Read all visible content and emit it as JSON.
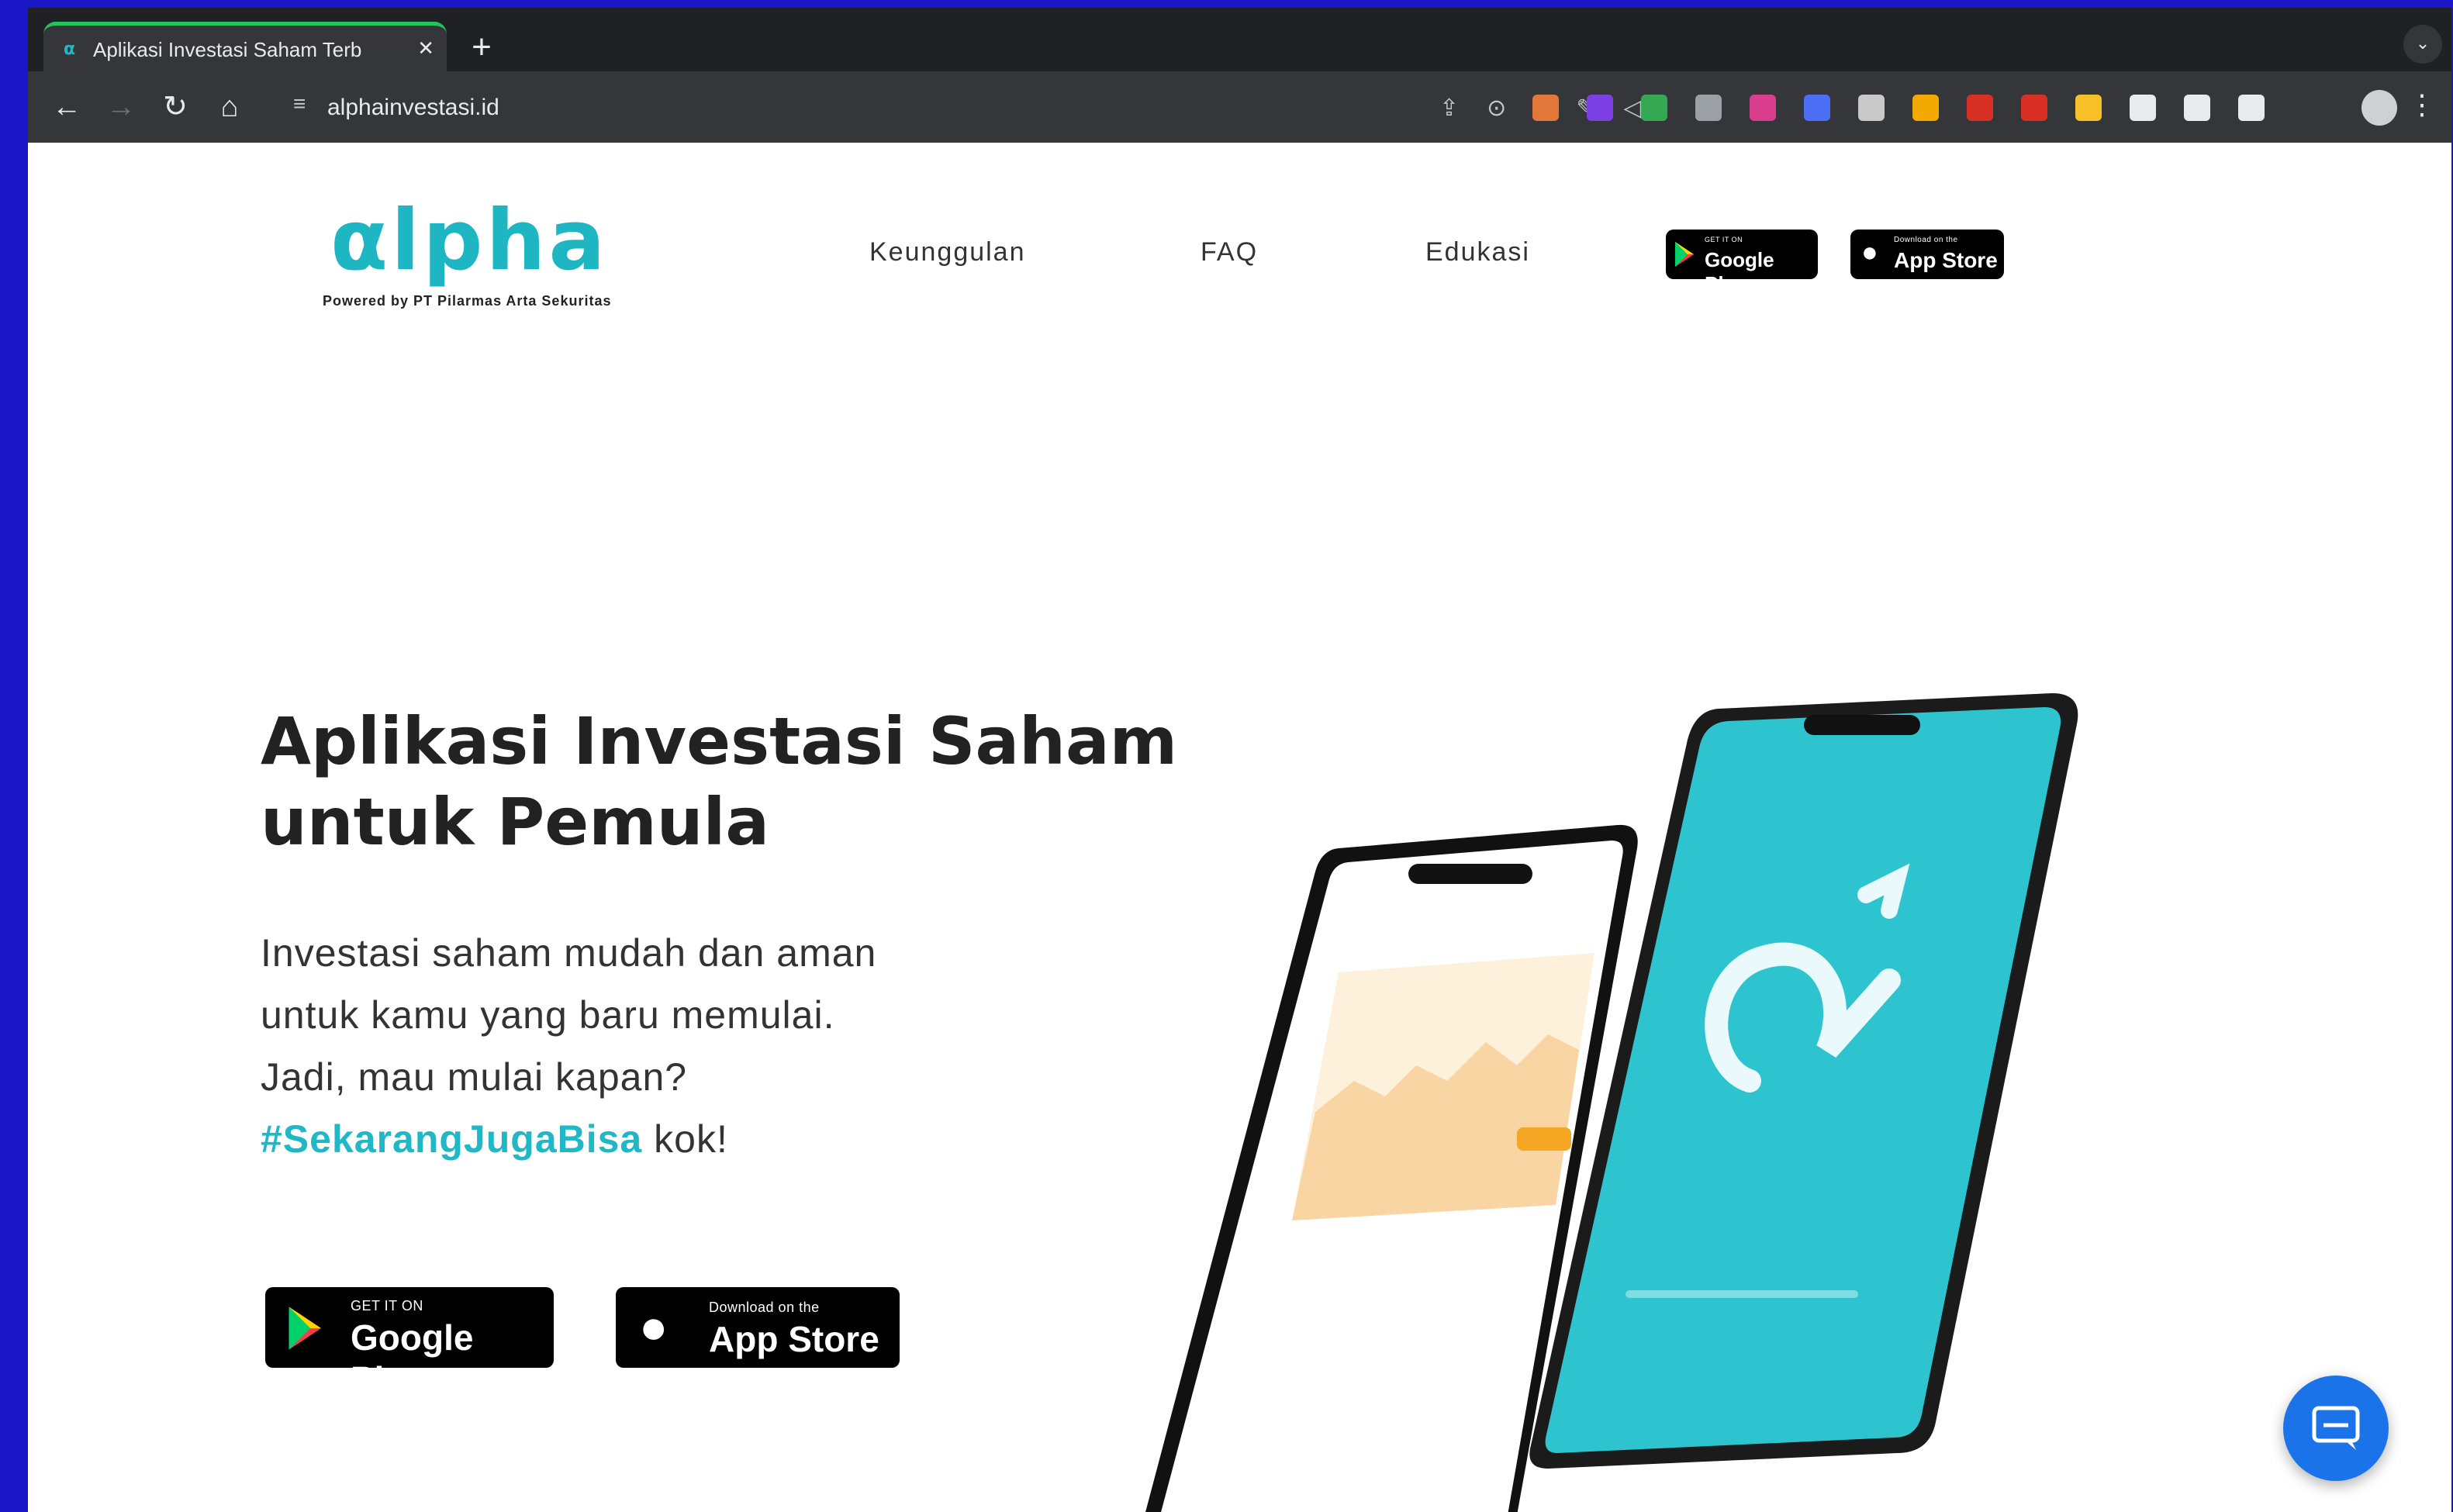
{
  "browser": {
    "tab_title": "Aplikasi Investasi Saham Terb",
    "tab_close": "✕",
    "new_tab": "+",
    "url": "alphainvestasi.id",
    "back": "←",
    "forward": "→",
    "reload": "↻",
    "home": "⌂",
    "kebab": "⋮",
    "extension_colors": [
      "#e2773a",
      "#7b3fe4",
      "#34a853",
      "#9aa0a6",
      "#d93e8e",
      "#4c6ef5",
      "#c9c9c9",
      "#f2a900",
      "#d93025",
      "#d93025",
      "#f6c026",
      "#e8eaed",
      "#e8eaed",
      "#e8eaed"
    ]
  },
  "site": {
    "logo_text": "αlpha",
    "logo_sub": "Powered by PT Pilarmas Arta Sekuritas",
    "nav": [
      {
        "label": "Keunggulan"
      },
      {
        "label": "FAQ"
      },
      {
        "label": "Edukasi"
      }
    ],
    "google_play": {
      "small": "GET IT ON",
      "main": "Google Play"
    },
    "app_store": {
      "small": "Download on the",
      "main": "App Store"
    },
    "hero": {
      "title_line1": "Aplikasi Investasi Saham",
      "title_line2": "untuk Pemula",
      "text_line1": "Investasi saham mudah dan aman",
      "text_line2": "untuk kamu yang baru memulai.",
      "text_line3": "Jadi, mau mulai kapan?",
      "hashtag": "#SekarangJugaBisa",
      "hashtag_suffix": " kok!"
    },
    "colors": {
      "brand": "#20b7c6",
      "phone_screen": "#2ec4cf",
      "chat": "#1a73e8"
    }
  }
}
